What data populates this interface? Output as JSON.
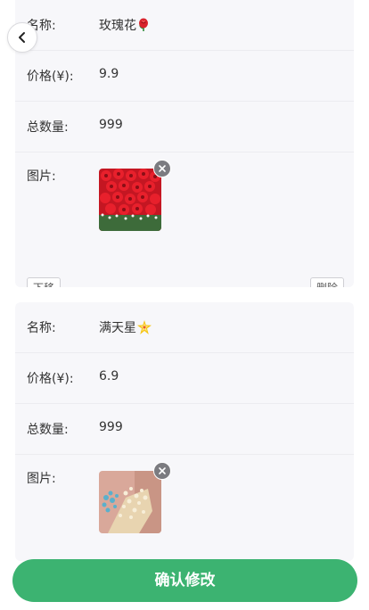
{
  "labels": {
    "name": "名称:",
    "price": "价格(¥):",
    "quantity": "总数量:",
    "image": "图片:"
  },
  "products": [
    {
      "name": "玫瑰花",
      "name_emoji_icon": "rose-icon",
      "price": "9.9",
      "quantity": "999",
      "image_icon": "red-roses-bouquet-image",
      "move_down_label": "下移",
      "delete_label": "删除"
    },
    {
      "name": "满天星",
      "name_emoji_icon": "sparkle-star-icon",
      "price": "6.9",
      "quantity": "999",
      "image_icon": "babys-breath-bouquet-image"
    }
  ],
  "confirm_label": "确认修改",
  "colors": {
    "accent": "#3cb371",
    "card_background": "#f7f7fa",
    "remove_badge": "#7b7b80"
  }
}
